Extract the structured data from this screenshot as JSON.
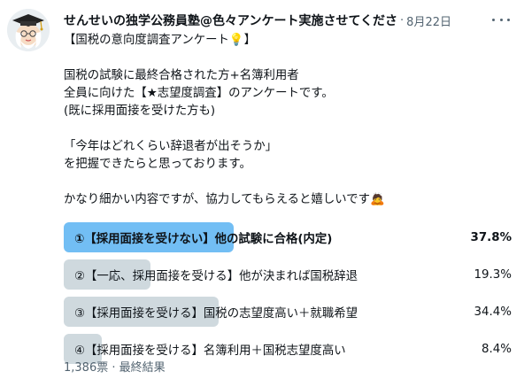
{
  "post": {
    "author": "せんせいの独学公務員塾@色々アンケート実施させてくださ",
    "separator": "·",
    "date": "8月22日",
    "lines": [
      "【国税の意向度調査アンケート💡】",
      "",
      "国税の試験に最終合格された方+名簿利用者",
      "全員に向けた【★志望度調査】のアンケートです。",
      "(既に採用面接を受けた方も)",
      "",
      "「今年はどれくらい辞退者が出そうか」",
      "を把握できたらと思っております。",
      "",
      "かなり細かい内容ですが、協力してもらえると嬉しいです🙇"
    ]
  },
  "poll": {
    "options": [
      {
        "label": "①【採用面接を受けない】他の試験に合格(内定)",
        "percent": "37.8%",
        "value": 37.8,
        "winner": true
      },
      {
        "label": "②【一応、採用面接を受ける】他が決まれば国税辞退",
        "percent": "19.3%",
        "value": 19.3,
        "winner": false
      },
      {
        "label": "③【採用面接を受ける】国税の志望度高い＋就職希望",
        "percent": "34.4%",
        "value": 34.4,
        "winner": false
      },
      {
        "label": "④【採用面接を受ける】名簿利用＋国税志望度高い",
        "percent": "8.4%",
        "value": 8.4,
        "winner": false
      }
    ],
    "footer": "1,386票 · 最終結果"
  },
  "icons": {
    "avatar": "teacher-avatar",
    "more": "more-options-icon"
  },
  "colors": {
    "winner_bar": "#72bef4",
    "bar": "#cfd9de",
    "secondary_text": "#536471"
  }
}
